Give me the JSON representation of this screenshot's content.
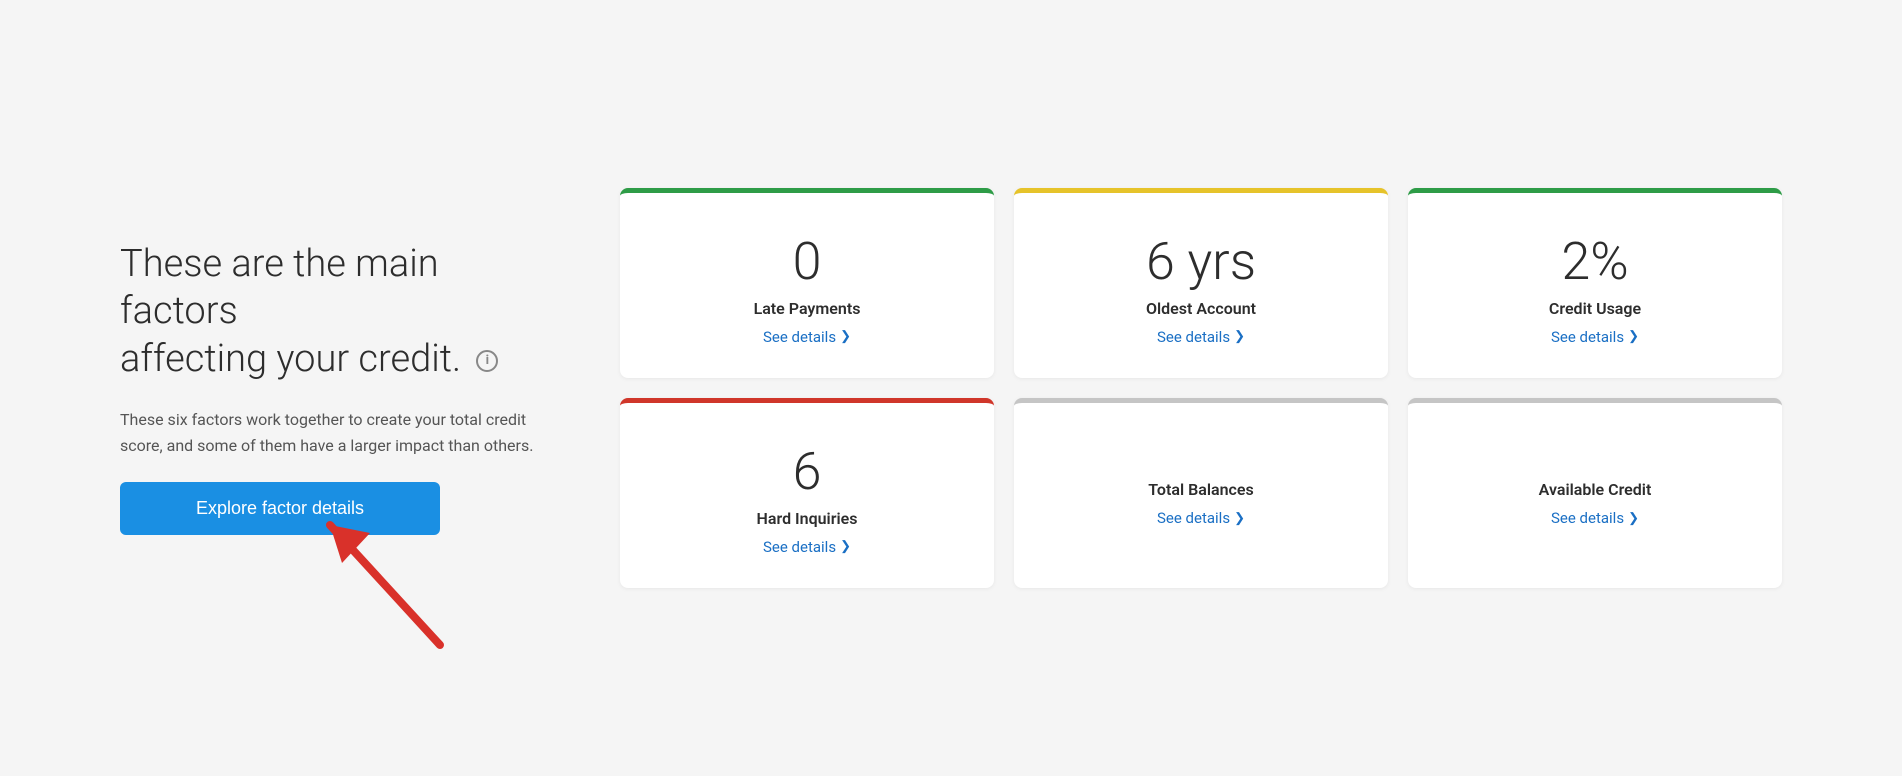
{
  "left": {
    "heading_line1": "These are the main factors",
    "heading_line2": "affecting your credit.",
    "info_icon_label": "i",
    "description": "These six factors work together to create your total credit score, and some of them have a larger impact than others.",
    "explore_button": "Explore factor details"
  },
  "cards": [
    {
      "id": "late-payments",
      "value": "0",
      "label": "Late Payments",
      "see_details": "See details",
      "color_class": "green"
    },
    {
      "id": "oldest-account",
      "value": "6 yrs",
      "label": "Oldest Account",
      "see_details": "See details",
      "color_class": "yellow"
    },
    {
      "id": "credit-usage",
      "value": "2%",
      "label": "Credit Usage",
      "see_details": "See details",
      "color_class": "green2"
    },
    {
      "id": "hard-inquiries",
      "value": "6",
      "label": "Hard Inquiries",
      "see_details": "See details",
      "color_class": "red"
    },
    {
      "id": "total-balances",
      "value": "",
      "label": "Total Balances",
      "see_details": "See details",
      "color_class": "gray"
    },
    {
      "id": "available-credit",
      "value": "",
      "label": "Available Credit",
      "see_details": "See details",
      "color_class": "gray2"
    }
  ],
  "arrow": {
    "color": "#d9312a"
  }
}
